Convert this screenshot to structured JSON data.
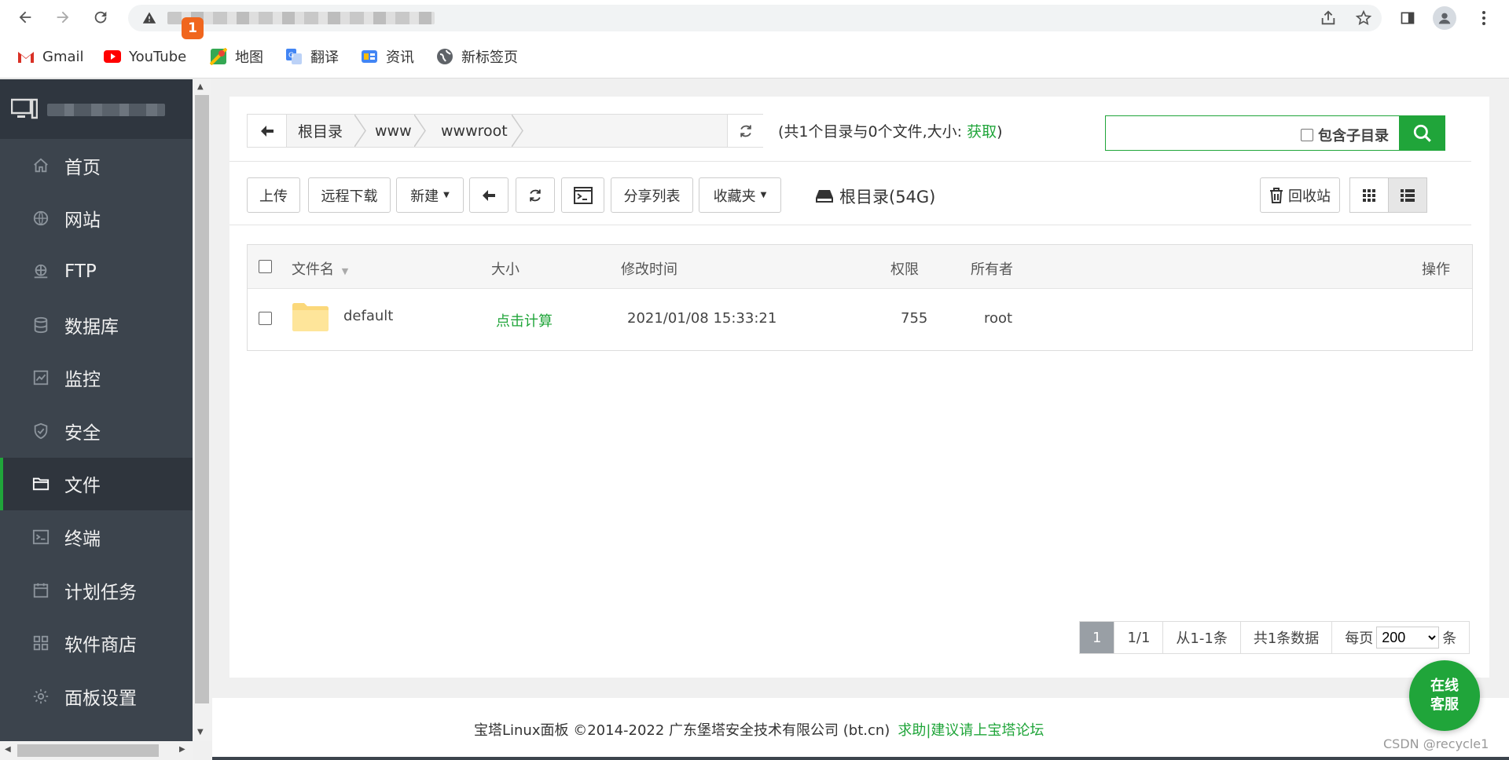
{
  "browser": {
    "bookmarks": [
      {
        "label": "Gmail",
        "icon": "gmail-icon"
      },
      {
        "label": "YouTube",
        "icon": "youtube-icon"
      },
      {
        "label": "地图",
        "icon": "maps-icon"
      },
      {
        "label": "翻译",
        "icon": "translate-icon"
      },
      {
        "label": "资讯",
        "icon": "news-icon"
      },
      {
        "label": "新标签页",
        "icon": "globe-icon"
      }
    ]
  },
  "sidebar": {
    "badge": "1",
    "items": [
      {
        "label": "首页",
        "icon": "home-icon"
      },
      {
        "label": "网站",
        "icon": "globe-icon"
      },
      {
        "label": "FTP",
        "icon": "ftp-icon"
      },
      {
        "label": "数据库",
        "icon": "database-icon"
      },
      {
        "label": "监控",
        "icon": "monitor-icon"
      },
      {
        "label": "安全",
        "icon": "shield-icon"
      },
      {
        "label": "文件",
        "icon": "folder-icon",
        "active": true
      },
      {
        "label": "终端",
        "icon": "terminal-icon"
      },
      {
        "label": "计划任务",
        "icon": "calendar-icon"
      },
      {
        "label": "软件商店",
        "icon": "apps-icon"
      },
      {
        "label": "面板设置",
        "icon": "gear-icon"
      }
    ]
  },
  "path": {
    "crumbs": [
      "根目录",
      "www",
      "wwwroot"
    ],
    "info_prefix": "(共1个目录与0个文件,大小:",
    "info_link": "获取",
    "info_suffix": ")"
  },
  "search": {
    "placeholder": "",
    "include_sub": "包含子目录"
  },
  "toolbar": {
    "upload": "上传",
    "remote_download": "远程下载",
    "new": "新建",
    "share_list": "分享列表",
    "favorites": "收藏夹",
    "disk": "根目录(54G)",
    "recycle": "回收站"
  },
  "table": {
    "headers": {
      "name": "文件名",
      "size": "大小",
      "mtime": "修改时间",
      "perm": "权限",
      "owner": "所有者",
      "ops": "操作"
    },
    "rows": [
      {
        "name": "default",
        "size": "点击计算",
        "mtime": "2021/01/08 15:33:21",
        "perm": "755",
        "owner": "root"
      }
    ]
  },
  "pager": {
    "current": "1",
    "pages": "1/1",
    "range": "从1-1条",
    "total": "共1条数据",
    "per_page_label": "每页",
    "per_page": "200",
    "per_page_unit": "条"
  },
  "footer": {
    "text": "宝塔Linux面板 ©2014-2022 广东堡塔安全技术有限公司 (bt.cn)",
    "link": "求助|建议请上宝塔论坛"
  },
  "service": {
    "line1": "在线",
    "line2": "客服"
  },
  "watermark": "CSDN @recycle1",
  "colors": {
    "accent": "#20a53a",
    "sidebar": "#3c444d",
    "badge": "#f0661e"
  }
}
